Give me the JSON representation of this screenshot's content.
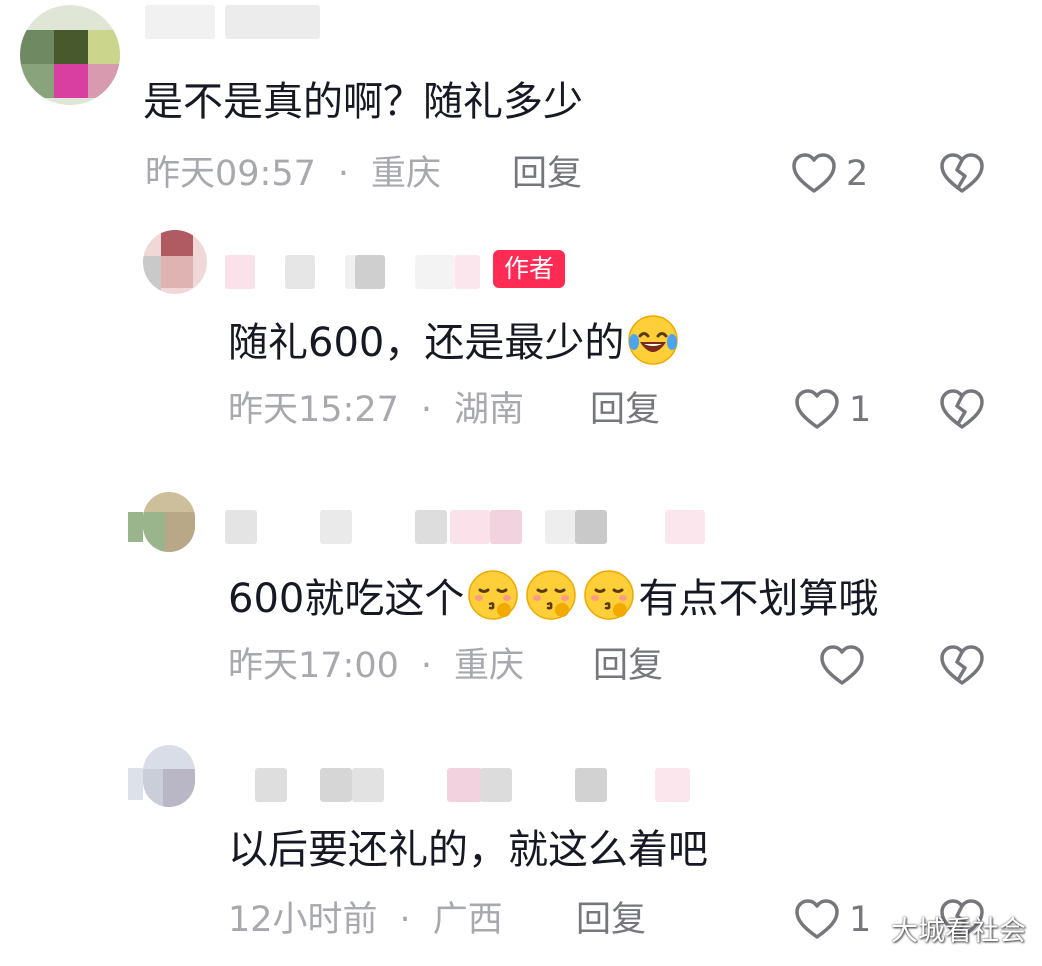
{
  "comments": [
    {
      "text": "是不是真的啊？随礼多少",
      "time": "昨天09:57",
      "location": "重庆",
      "reply_label": "回复",
      "likes": "2",
      "is_author": false
    },
    {
      "author_badge": "作者",
      "text": "随礼600，还是最少的",
      "time": "昨天15:27",
      "location": "湖南",
      "reply_label": "回复",
      "likes": "1",
      "is_author": true
    },
    {
      "text_before": "600就吃这个",
      "text_after": "有点不划算哦",
      "time": "昨天17:00",
      "location": "重庆",
      "reply_label": "回复",
      "likes": "",
      "is_author": false
    },
    {
      "text": "以后要还礼的，就这么着吧",
      "time": "12小时前",
      "location": "广西",
      "reply_label": "回复",
      "likes": "1",
      "is_author": false
    }
  ],
  "watermark": "大城看社会",
  "colors": {
    "author_badge": "#fe2c55",
    "meta_text": "#a7a9ae",
    "action_icon": "#75777d"
  },
  "icons": [
    "heart-outline-icon",
    "broken-heart-icon",
    "laughing-tears-emoji",
    "kissing-emoji"
  ]
}
